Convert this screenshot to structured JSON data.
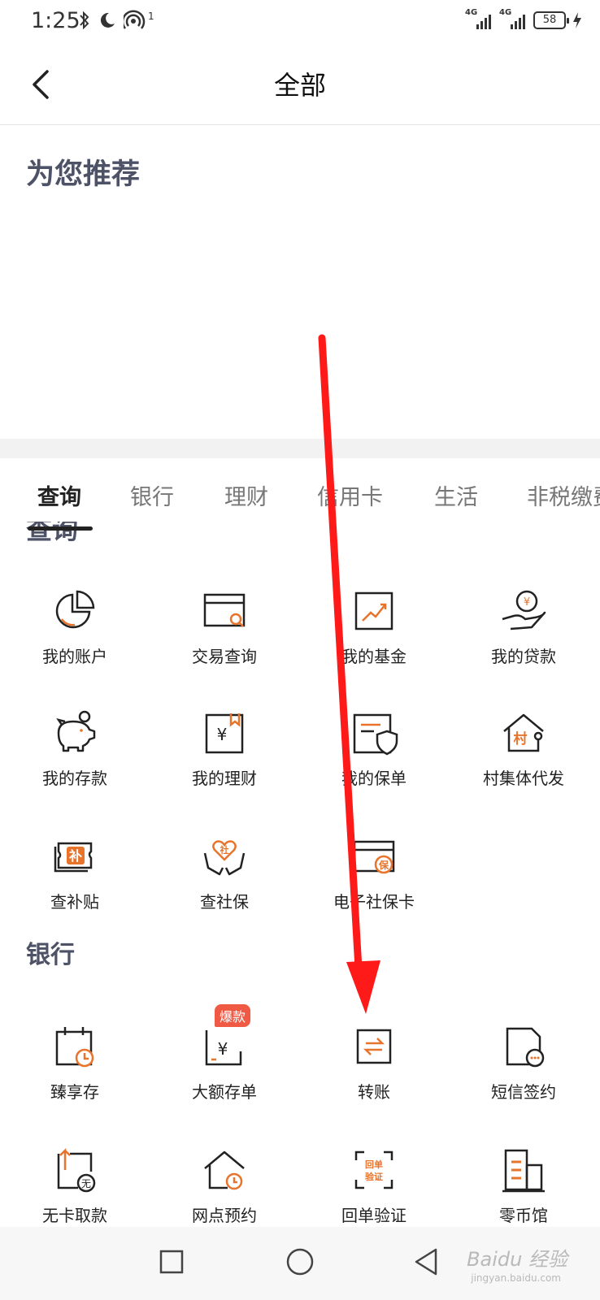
{
  "status_bar": {
    "time": "1:25",
    "signal1_label": "4G",
    "signal2_label": "4G",
    "battery": "58",
    "notif_count": "1"
  },
  "header": {
    "title": "全部"
  },
  "recommend": {
    "title": "为您推荐"
  },
  "tabs": [
    {
      "label": "查询",
      "active": true
    },
    {
      "label": "银行"
    },
    {
      "label": "理财"
    },
    {
      "label": "信用卡"
    },
    {
      "label": "生活"
    },
    {
      "label": "非税缴费"
    }
  ],
  "peek_section_label": "查询",
  "query_section": {
    "items": [
      {
        "label": "我的账户",
        "icon": "pie-chart-icon"
      },
      {
        "label": "交易查询",
        "icon": "card-search-icon"
      },
      {
        "label": "我的基金",
        "icon": "trend-chart-icon"
      },
      {
        "label": "我的贷款",
        "icon": "hand-coin-icon"
      },
      {
        "label": "我的存款",
        "icon": "piggy-bank-icon"
      },
      {
        "label": "我的理财",
        "icon": "yuan-bookmark-icon"
      },
      {
        "label": "我的保单",
        "icon": "policy-shield-icon"
      },
      {
        "label": "村集体代发",
        "icon": "village-house-icon"
      },
      {
        "label": "查补贴",
        "icon": "subsidy-ticket-icon"
      },
      {
        "label": "查社保",
        "icon": "social-security-hands-icon"
      },
      {
        "label": "电子社保卡",
        "icon": "social-security-card-icon"
      }
    ]
  },
  "bank_section": {
    "title": "银行",
    "items": [
      {
        "label": "臻享存",
        "icon": "calendar-clock-icon"
      },
      {
        "label": "大额存单",
        "icon": "deposit-certificate-icon",
        "badge": "爆款"
      },
      {
        "label": "转账",
        "icon": "transfer-icon"
      },
      {
        "label": "短信签约",
        "icon": "sms-document-icon"
      },
      {
        "label": "无卡取款",
        "icon": "cardless-withdraw-icon",
        "icon_text": "无"
      },
      {
        "label": "网点预约",
        "icon": "branch-appointment-icon"
      },
      {
        "label": "回单验证",
        "icon": "receipt-verify-icon",
        "icon_text": "回单 验证"
      },
      {
        "label": "零币馆",
        "icon": "coin-building-icon"
      }
    ]
  },
  "icon_glyphs": {
    "yuan": "¥",
    "cun": "村",
    "bu": "补",
    "she": "社",
    "bao": "保",
    "wu": "无",
    "hui_dan": "回单",
    "yan_zheng": "验证"
  },
  "watermark": {
    "text": "Baidu 经验",
    "sub": "jingyan.baidu.com"
  },
  "colors": {
    "accent": "#e8742c",
    "title": "#4d5267",
    "badge": "#f05a44",
    "annotation": "#ff1a1a"
  }
}
